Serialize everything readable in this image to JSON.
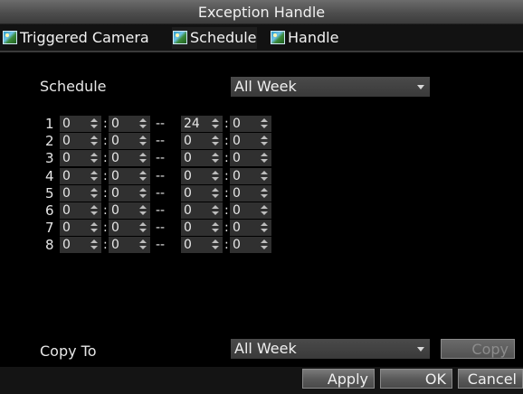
{
  "window": {
    "title": "Exception Handle"
  },
  "tabs": [
    {
      "label": "Triggered Camera",
      "icon": "picture-icon"
    },
    {
      "label": "Schedule",
      "icon": "picture-icon"
    },
    {
      "label": "Handle",
      "icon": "picture-icon"
    }
  ],
  "active_tab": "Schedule",
  "schedule": {
    "label": "Schedule",
    "value": "All Week"
  },
  "time_rows": [
    {
      "index": "1",
      "start_hour": "0",
      "start_min": "0",
      "end_hour": "24",
      "end_min": "0"
    },
    {
      "index": "2",
      "start_hour": "0",
      "start_min": "0",
      "end_hour": "0",
      "end_min": "0"
    },
    {
      "index": "3",
      "start_hour": "0",
      "start_min": "0",
      "end_hour": "0",
      "end_min": "0"
    },
    {
      "index": "4",
      "start_hour": "0",
      "start_min": "0",
      "end_hour": "0",
      "end_min": "0"
    },
    {
      "index": "5",
      "start_hour": "0",
      "start_min": "0",
      "end_hour": "0",
      "end_min": "0"
    },
    {
      "index": "6",
      "start_hour": "0",
      "start_min": "0",
      "end_hour": "0",
      "end_min": "0"
    },
    {
      "index": "7",
      "start_hour": "0",
      "start_min": "0",
      "end_hour": "0",
      "end_min": "0"
    },
    {
      "index": "8",
      "start_hour": "0",
      "start_min": "0",
      "end_hour": "0",
      "end_min": "0"
    }
  ],
  "time_separator": ":",
  "range_separator": "--",
  "copy_to": {
    "label": "Copy To",
    "value": "All Week",
    "button": "Copy"
  },
  "footer": {
    "apply": "Apply",
    "ok": "OK",
    "cancel": "Cancel"
  }
}
